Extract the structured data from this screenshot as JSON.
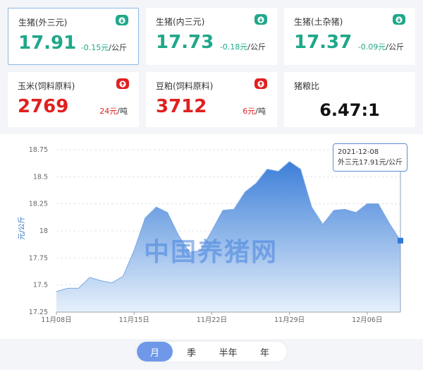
{
  "price_cards": [
    {
      "title": "生猪(外三元)",
      "value": "17.91",
      "change": "-0.15元",
      "unit": "/公斤",
      "trend": "down",
      "value_color": "#1fa889",
      "change_color": "#1fa889"
    },
    {
      "title": "生猪(内三元)",
      "value": "17.73",
      "change": "-0.18元",
      "unit": "/公斤",
      "trend": "down",
      "value_color": "#1fa889",
      "change_color": "#1fa889"
    },
    {
      "title": "生猪(土杂猪)",
      "value": "17.37",
      "change": "-0.09元",
      "unit": "/公斤",
      "trend": "down",
      "value_color": "#1fa889",
      "change_color": "#1fa889"
    },
    {
      "title": "玉米(饲料原料)",
      "value": "2769",
      "change": "24元",
      "unit": "/吨",
      "trend": "up",
      "value_color": "#e02020",
      "change_color": "#e02020"
    },
    {
      "title": "豆粕(饲料原料)",
      "value": "3712",
      "change": "6元",
      "unit": "/吨",
      "trend": "up",
      "value_color": "#e02020",
      "change_color": "#e02020"
    }
  ],
  "ratio_card": {
    "title": "猪粮比",
    "value": "6.47:1"
  },
  "colors": {
    "down_badge": "#1fa889",
    "up_badge": "#e02020",
    "area_top": "#3d7fd8",
    "area_bottom": "#e6f0fb",
    "marker": "#2f7ad6"
  },
  "chart_data": {
    "type": "area",
    "ylabel": "元/公斤",
    "yticks": [
      "17.25",
      "17.5",
      "17.75",
      "18",
      "18.25",
      "18.5",
      "18.75"
    ],
    "ylim": [
      17.25,
      18.75
    ],
    "xticks": [
      {
        "label": "11月08日",
        "index": 0
      },
      {
        "label": "11月15日",
        "index": 7
      },
      {
        "label": "11月22日",
        "index": 14
      },
      {
        "label": "11月29日",
        "index": 21
      },
      {
        "label": "12月06日",
        "index": 28
      }
    ],
    "dates": [
      "2021-11-08",
      "2021-11-09",
      "2021-11-10",
      "2021-11-11",
      "2021-11-12",
      "2021-11-13",
      "2021-11-14",
      "2021-11-15",
      "2021-11-16",
      "2021-11-17",
      "2021-11-18",
      "2021-11-19",
      "2021-11-20",
      "2021-11-21",
      "2021-11-22",
      "2021-11-23",
      "2021-11-24",
      "2021-11-25",
      "2021-11-26",
      "2021-11-27",
      "2021-11-28",
      "2021-11-29",
      "2021-11-30",
      "2021-12-01",
      "2021-12-02",
      "2021-12-03",
      "2021-12-04",
      "2021-12-05",
      "2021-12-06",
      "2021-12-07",
      "2021-12-08"
    ],
    "values": [
      17.44,
      17.47,
      17.47,
      17.57,
      17.54,
      17.52,
      17.58,
      17.82,
      18.12,
      18.22,
      18.17,
      17.96,
      17.8,
      17.82,
      18.0,
      18.19,
      18.2,
      18.36,
      18.44,
      18.57,
      18.55,
      18.64,
      18.57,
      18.22,
      18.06,
      18.19,
      18.2,
      18.17,
      18.25,
      18.25,
      18.07,
      17.91
    ],
    "grid": true,
    "tooltip": {
      "date": "2021-12-08",
      "text": "外三元17.91元/公斤"
    }
  },
  "watermark": "中国养猪网",
  "range_tabs": [
    {
      "label": "月",
      "active": true
    },
    {
      "label": "季",
      "active": false
    },
    {
      "label": "半年",
      "active": false
    },
    {
      "label": "年",
      "active": false
    }
  ]
}
